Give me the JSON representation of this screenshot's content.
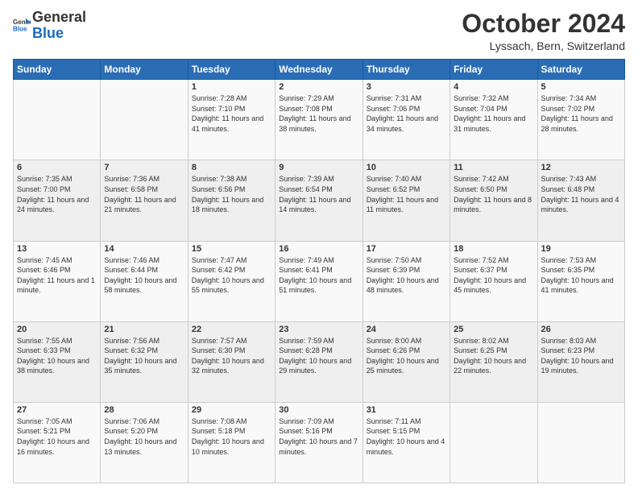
{
  "header": {
    "logo_general": "General",
    "logo_blue": "Blue",
    "month": "October 2024",
    "location": "Lyssach, Bern, Switzerland"
  },
  "days_of_week": [
    "Sunday",
    "Monday",
    "Tuesday",
    "Wednesday",
    "Thursday",
    "Friday",
    "Saturday"
  ],
  "weeks": [
    [
      {
        "day": "",
        "info": ""
      },
      {
        "day": "",
        "info": ""
      },
      {
        "day": "1",
        "info": "Sunrise: 7:28 AM\nSunset: 7:10 PM\nDaylight: 11 hours and 41 minutes."
      },
      {
        "day": "2",
        "info": "Sunrise: 7:29 AM\nSunset: 7:08 PM\nDaylight: 11 hours and 38 minutes."
      },
      {
        "day": "3",
        "info": "Sunrise: 7:31 AM\nSunset: 7:06 PM\nDaylight: 11 hours and 34 minutes."
      },
      {
        "day": "4",
        "info": "Sunrise: 7:32 AM\nSunset: 7:04 PM\nDaylight: 11 hours and 31 minutes."
      },
      {
        "day": "5",
        "info": "Sunrise: 7:34 AM\nSunset: 7:02 PM\nDaylight: 11 hours and 28 minutes."
      }
    ],
    [
      {
        "day": "6",
        "info": "Sunrise: 7:35 AM\nSunset: 7:00 PM\nDaylight: 11 hours and 24 minutes."
      },
      {
        "day": "7",
        "info": "Sunrise: 7:36 AM\nSunset: 6:58 PM\nDaylight: 11 hours and 21 minutes."
      },
      {
        "day": "8",
        "info": "Sunrise: 7:38 AM\nSunset: 6:56 PM\nDaylight: 11 hours and 18 minutes."
      },
      {
        "day": "9",
        "info": "Sunrise: 7:39 AM\nSunset: 6:54 PM\nDaylight: 11 hours and 14 minutes."
      },
      {
        "day": "10",
        "info": "Sunrise: 7:40 AM\nSunset: 6:52 PM\nDaylight: 11 hours and 11 minutes."
      },
      {
        "day": "11",
        "info": "Sunrise: 7:42 AM\nSunset: 6:50 PM\nDaylight: 11 hours and 8 minutes."
      },
      {
        "day": "12",
        "info": "Sunrise: 7:43 AM\nSunset: 6:48 PM\nDaylight: 11 hours and 4 minutes."
      }
    ],
    [
      {
        "day": "13",
        "info": "Sunrise: 7:45 AM\nSunset: 6:46 PM\nDaylight: 11 hours and 1 minute."
      },
      {
        "day": "14",
        "info": "Sunrise: 7:46 AM\nSunset: 6:44 PM\nDaylight: 10 hours and 58 minutes."
      },
      {
        "day": "15",
        "info": "Sunrise: 7:47 AM\nSunset: 6:42 PM\nDaylight: 10 hours and 55 minutes."
      },
      {
        "day": "16",
        "info": "Sunrise: 7:49 AM\nSunset: 6:41 PM\nDaylight: 10 hours and 51 minutes."
      },
      {
        "day": "17",
        "info": "Sunrise: 7:50 AM\nSunset: 6:39 PM\nDaylight: 10 hours and 48 minutes."
      },
      {
        "day": "18",
        "info": "Sunrise: 7:52 AM\nSunset: 6:37 PM\nDaylight: 10 hours and 45 minutes."
      },
      {
        "day": "19",
        "info": "Sunrise: 7:53 AM\nSunset: 6:35 PM\nDaylight: 10 hours and 41 minutes."
      }
    ],
    [
      {
        "day": "20",
        "info": "Sunrise: 7:55 AM\nSunset: 6:33 PM\nDaylight: 10 hours and 38 minutes."
      },
      {
        "day": "21",
        "info": "Sunrise: 7:56 AM\nSunset: 6:32 PM\nDaylight: 10 hours and 35 minutes."
      },
      {
        "day": "22",
        "info": "Sunrise: 7:57 AM\nSunset: 6:30 PM\nDaylight: 10 hours and 32 minutes."
      },
      {
        "day": "23",
        "info": "Sunrise: 7:59 AM\nSunset: 6:28 PM\nDaylight: 10 hours and 29 minutes."
      },
      {
        "day": "24",
        "info": "Sunrise: 8:00 AM\nSunset: 6:26 PM\nDaylight: 10 hours and 25 minutes."
      },
      {
        "day": "25",
        "info": "Sunrise: 8:02 AM\nSunset: 6:25 PM\nDaylight: 10 hours and 22 minutes."
      },
      {
        "day": "26",
        "info": "Sunrise: 8:03 AM\nSunset: 6:23 PM\nDaylight: 10 hours and 19 minutes."
      }
    ],
    [
      {
        "day": "27",
        "info": "Sunrise: 7:05 AM\nSunset: 5:21 PM\nDaylight: 10 hours and 16 minutes."
      },
      {
        "day": "28",
        "info": "Sunrise: 7:06 AM\nSunset: 5:20 PM\nDaylight: 10 hours and 13 minutes."
      },
      {
        "day": "29",
        "info": "Sunrise: 7:08 AM\nSunset: 5:18 PM\nDaylight: 10 hours and 10 minutes."
      },
      {
        "day": "30",
        "info": "Sunrise: 7:09 AM\nSunset: 5:16 PM\nDaylight: 10 hours and 7 minutes."
      },
      {
        "day": "31",
        "info": "Sunrise: 7:11 AM\nSunset: 5:15 PM\nDaylight: 10 hours and 4 minutes."
      },
      {
        "day": "",
        "info": ""
      },
      {
        "day": "",
        "info": ""
      }
    ]
  ]
}
